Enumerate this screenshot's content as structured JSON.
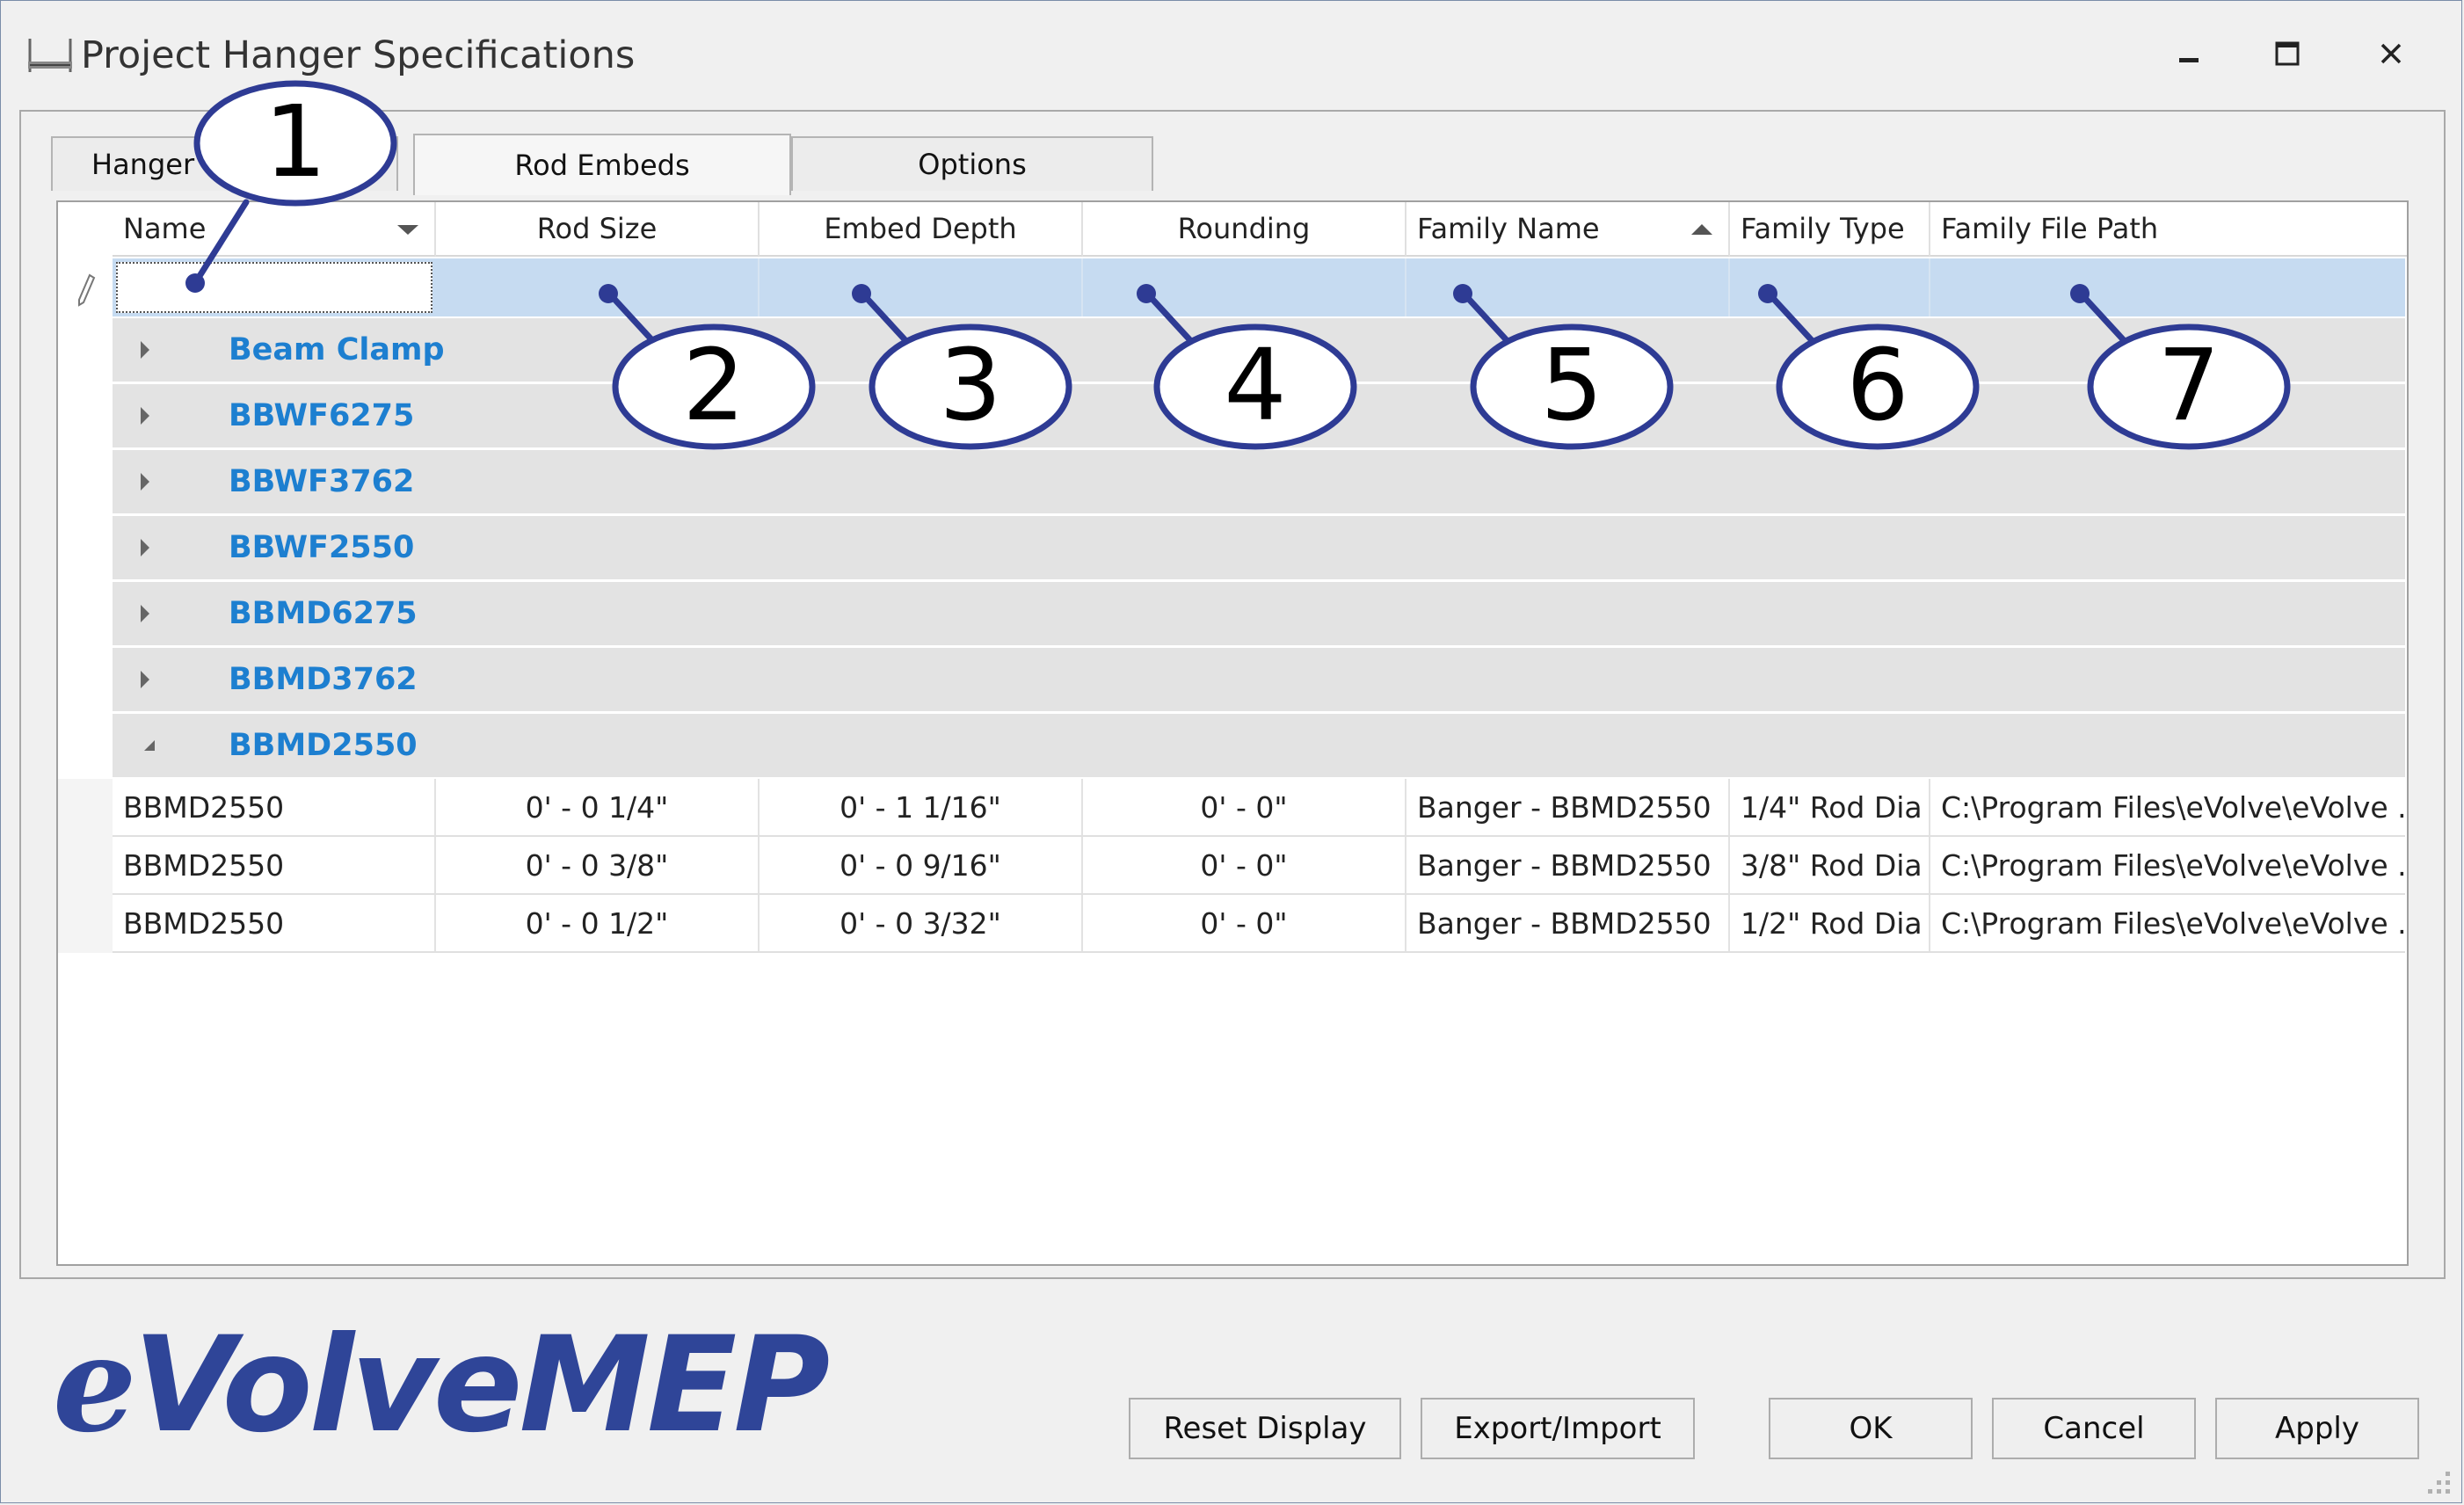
{
  "window": {
    "title": "Project Hanger Specifications",
    "icon": "hanger-icon",
    "controls": [
      "minimize-icon",
      "maximize-icon",
      "close-icon"
    ]
  },
  "tabs": [
    {
      "label": "Hanger C",
      "active": false
    },
    {
      "label": "Rod Embeds",
      "active": true
    },
    {
      "label": "Options",
      "active": false
    }
  ],
  "grid": {
    "columns": [
      "Name",
      "Rod Size",
      "Embed Depth",
      "Rounding",
      "Family Name",
      "Family Type",
      "Family File Path"
    ],
    "name_column_icon": "dropdown-arrow-icon",
    "sorted_column": "Family Name",
    "sort_icon": "sort-ascending-icon",
    "filter_row_icon": "pencil-icon",
    "groups": [
      {
        "label": "Beam Clamp",
        "expanded": false
      },
      {
        "label": "BBWF6275",
        "expanded": false
      },
      {
        "label": "BBWF3762",
        "expanded": false
      },
      {
        "label": "BBWF2550",
        "expanded": false
      },
      {
        "label": "BBMD6275",
        "expanded": false
      },
      {
        "label": "BBMD3762",
        "expanded": false
      },
      {
        "label": "BBMD2550",
        "expanded": true
      }
    ],
    "rows": [
      {
        "name": "BBMD2550",
        "rod_size": "0' - 0 1/4\"",
        "embed_depth": "0' - 1 1/16\"",
        "rounding": "0' - 0\"",
        "family_name": "Banger - BBMD2550",
        "family_type": "1/4\" Rod Dia",
        "family_file_path": "C:\\Program Files\\eVolve\\eVolve ..."
      },
      {
        "name": "BBMD2550",
        "rod_size": "0' - 0 3/8\"",
        "embed_depth": "0' - 0 9/16\"",
        "rounding": "0' - 0\"",
        "family_name": "Banger - BBMD2550",
        "family_type": "3/8\" Rod Dia",
        "family_file_path": "C:\\Program Files\\eVolve\\eVolve ..."
      },
      {
        "name": "BBMD2550",
        "rod_size": "0' - 0 1/2\"",
        "embed_depth": "0' - 0 3/32\"",
        "rounding": "0' - 0\"",
        "family_name": "Banger - BBMD2550",
        "family_type": "1/2\" Rod Dia",
        "family_file_path": "C:\\Program Files\\eVolve\\eVolve ..."
      }
    ]
  },
  "logo": {
    "e": "e",
    "rest": "VolveMEP",
    "color": "#2f4598"
  },
  "buttons": {
    "reset": "Reset Display",
    "export": "Export/Import",
    "ok": "OK",
    "cancel": "Cancel",
    "apply": "Apply"
  },
  "callouts": [
    "1",
    "2",
    "3",
    "4",
    "5",
    "6",
    "7"
  ],
  "colors": {
    "callout_border": "#2e3b94",
    "group_label": "#1d7fd0",
    "filter_row": "#c6dbf1",
    "group_row": "#e3e3e3"
  }
}
